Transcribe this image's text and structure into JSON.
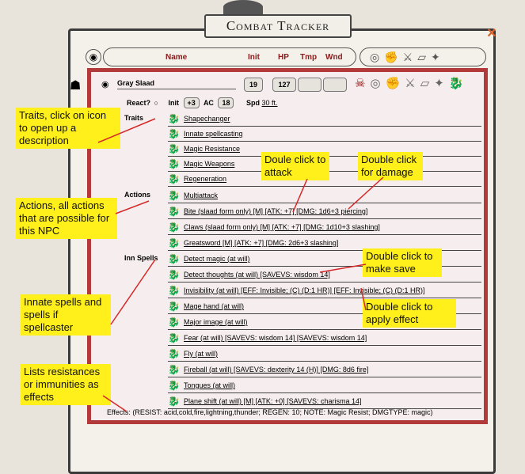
{
  "window": {
    "title": "Combat Tracker",
    "close_glyph": "×"
  },
  "header": {
    "eye": "◉",
    "name": "Name",
    "init": "Init",
    "hp": "HP",
    "tmp": "Tmp",
    "wnd": "Wnd"
  },
  "npc": {
    "name": "Gray Slaad",
    "init": "19",
    "hp": "127",
    "tmp": "",
    "wnd": "",
    "react_label": "React?",
    "init_label": "Init",
    "init_mod": "+3",
    "ac_label": "AC",
    "ac": "18",
    "spd_label": "Spd",
    "spd": "30 ft."
  },
  "sections": {
    "traits": "Traits",
    "actions": "Actions",
    "inn_spells": "Inn Spells"
  },
  "traits": [
    "Shapechanger",
    "Innate spellcasting",
    "Magic Resistance",
    "Magic Weapons",
    "Regeneration"
  ],
  "actions": [
    "Multiattack",
    "Bite (slaad form only) [M] [ATK: +7] [DMG: 1d6+3 piercing]",
    "Claws (slaad form only) [M] [ATK: +7] [DMG: 1d10+3 slashing]",
    "Greatsword [M] [ATK: +7] [DMG: 2d6+3 slashing]"
  ],
  "spells": [
    "Detect magic (at will)",
    "Detect thoughts (at will) [SAVEVS: wisdom 14]",
    "Invisibility (at will) [EFF: Invisible; (C) (D:1 HR)] [EFF: Invisible; (C) (D:1 HR)]",
    "Mage hand (at will)",
    "Major image (at will)",
    "Fear (at will) [SAVEVS: wisdom 14] [SAVEVS: wisdom 14]",
    "Fly (at will)",
    "Fireball (at will) [SAVEVS: dexterity 14 (H)] [DMG: 8d6 fire]",
    "Tongues (at will)",
    "Plane shift (at will) [M] [ATK: +0] [SAVEVS: charisma 14]"
  ],
  "effects": "Effects: (RESIST: acid,cold,fire,lightning,thunder; REGEN: 10; NOTE: Magic Resist; DMGTYPE: magic)",
  "callouts": {
    "traits": "Traits, click on icon to open up a description",
    "actions": "Actions, all actions that are possible for this NPC",
    "spells": "Innate spells and spells if spellcaster",
    "effects": "Lists resistances or immunities as effects",
    "attack": "Doule click to attack",
    "damage": "Double click for damage",
    "save": "Double click to make save",
    "apply": "Double click to apply effect"
  },
  "colors": {
    "accent": "#b23a3a",
    "callout": "#ffef1a",
    "icon": "#c0252a"
  }
}
